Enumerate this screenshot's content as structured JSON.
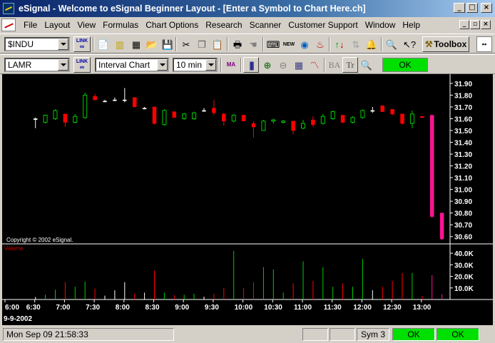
{
  "app": {
    "title": "eSignal - Welcome to eSignal Beginner Layout - [Enter a Symbol to Chart Here.ch]",
    "window_buttons": [
      "_",
      "□",
      "×"
    ],
    "mdi_buttons": [
      "_",
      "▫",
      "×"
    ]
  },
  "menu": [
    "File",
    "Layout",
    "View",
    "Formulas",
    "Chart Options",
    "Research",
    "Scanner",
    "Customer Support",
    "Window",
    "Help"
  ],
  "toolbar1": {
    "symbol_value": "$INDU",
    "link_label": "LINK",
    "toolbox_label": "Toolbox"
  },
  "toolbar2": {
    "symbol_value": "LAMR",
    "link_label": "LINK",
    "chart_type": "Interval Chart",
    "interval": "10 min",
    "ok_label": "OK",
    "ba_label": "BA",
    "tr_label": "Tr"
  },
  "chart_data": {
    "type": "candlestick",
    "copyright": "Copyright © 2002 eSignal.",
    "volume_label": "Volume",
    "date_label": "9-9-2002",
    "y_ticks": [
      31.9,
      31.8,
      31.7,
      31.6,
      31.5,
      31.4,
      31.3,
      31.2,
      31.1,
      31.0,
      30.9,
      30.8,
      30.7,
      30.6
    ],
    "ylim": [
      30.55,
      31.96
    ],
    "volume_ticks": [
      "40.0K",
      "30.0K",
      "20.0K",
      "10.0K"
    ],
    "volume_ylim": [
      0,
      45000
    ],
    "x_ticks": [
      "6:00",
      "6:30",
      "7:00",
      "7:30",
      "8:00",
      "8:30",
      "9:00",
      "9:30",
      "10:00",
      "10:30",
      "11:00",
      "11:30",
      "12:00",
      "12:30",
      "13:00"
    ],
    "bar_minutes": 10,
    "candles": [
      {
        "o": 31.6,
        "h": 31.61,
        "l": 31.52,
        "c": 31.6
      },
      {
        "o": 31.57,
        "h": 31.63,
        "l": 31.56,
        "c": 31.63
      },
      {
        "o": 31.6,
        "h": 31.68,
        "l": 31.59,
        "c": 31.67
      },
      {
        "o": 31.64,
        "h": 31.64,
        "l": 31.53,
        "c": 31.57
      },
      {
        "o": 31.57,
        "h": 31.64,
        "l": 31.56,
        "c": 31.62
      },
      {
        "o": 31.61,
        "h": 31.82,
        "l": 31.6,
        "c": 31.8
      },
      {
        "o": 31.79,
        "h": 31.81,
        "l": 31.76,
        "c": 31.76
      },
      {
        "o": 31.75,
        "h": 31.76,
        "l": 31.74,
        "c": 31.75
      },
      {
        "o": 31.76,
        "h": 31.78,
        "l": 31.75,
        "c": 31.76
      },
      {
        "o": 31.76,
        "h": 31.86,
        "l": 31.74,
        "c": 31.76
      },
      {
        "o": 31.78,
        "h": 31.78,
        "l": 31.7,
        "c": 31.7
      },
      {
        "o": 31.69,
        "h": 31.7,
        "l": 31.68,
        "c": 31.69
      },
      {
        "o": 31.7,
        "h": 31.7,
        "l": 31.55,
        "c": 31.56
      },
      {
        "o": 31.55,
        "h": 31.68,
        "l": 31.54,
        "c": 31.67
      },
      {
        "o": 31.66,
        "h": 31.66,
        "l": 31.61,
        "c": 31.61
      },
      {
        "o": 31.6,
        "h": 31.65,
        "l": 31.59,
        "c": 31.64
      },
      {
        "o": 31.6,
        "h": 31.66,
        "l": 31.59,
        "c": 31.65
      },
      {
        "o": 31.67,
        "h": 31.69,
        "l": 31.66,
        "c": 31.67
      },
      {
        "o": 31.69,
        "h": 31.76,
        "l": 31.63,
        "c": 31.65
      },
      {
        "o": 31.64,
        "h": 31.65,
        "l": 31.54,
        "c": 31.58
      },
      {
        "o": 31.58,
        "h": 31.64,
        "l": 31.57,
        "c": 31.63
      },
      {
        "o": 31.63,
        "h": 31.63,
        "l": 31.58,
        "c": 31.58
      },
      {
        "o": 31.56,
        "h": 31.58,
        "l": 31.44,
        "c": 31.53
      },
      {
        "o": 31.5,
        "h": 31.59,
        "l": 31.5,
        "c": 31.58
      },
      {
        "o": 31.58,
        "h": 31.6,
        "l": 31.56,
        "c": 31.59
      },
      {
        "o": 31.57,
        "h": 31.59,
        "l": 31.56,
        "c": 31.58
      },
      {
        "o": 31.58,
        "h": 31.58,
        "l": 31.47,
        "c": 31.5
      },
      {
        "o": 31.52,
        "h": 31.59,
        "l": 31.51,
        "c": 31.56
      },
      {
        "o": 31.59,
        "h": 31.62,
        "l": 31.53,
        "c": 31.55
      },
      {
        "o": 31.56,
        "h": 31.64,
        "l": 31.55,
        "c": 31.62
      },
      {
        "o": 31.6,
        "h": 31.67,
        "l": 31.59,
        "c": 31.66
      },
      {
        "o": 31.63,
        "h": 31.63,
        "l": 31.56,
        "c": 31.57
      },
      {
        "o": 31.57,
        "h": 31.62,
        "l": 31.56,
        "c": 31.61
      },
      {
        "o": 31.61,
        "h": 31.68,
        "l": 31.6,
        "c": 31.67
      },
      {
        "o": 31.67,
        "h": 31.7,
        "l": 31.65,
        "c": 31.67
      },
      {
        "o": 31.71,
        "h": 31.71,
        "l": 31.66,
        "c": 31.66
      },
      {
        "o": 31.68,
        "h": 31.68,
        "l": 31.63,
        "c": 31.64
      },
      {
        "o": 31.64,
        "h": 31.64,
        "l": 31.55,
        "c": 31.56
      },
      {
        "o": 31.56,
        "h": 31.67,
        "l": 31.52,
        "c": 31.64
      },
      {
        "o": 31.62,
        "h": 31.62,
        "l": 31.61,
        "c": 31.61
      },
      {
        "o": 31.63,
        "h": 31.63,
        "l": 30.76,
        "c": 30.77
      },
      {
        "o": 30.8,
        "h": 30.8,
        "l": 30.57,
        "c": 30.58
      }
    ],
    "volumes": [
      2200,
      4200,
      8500,
      15000,
      11000,
      15500,
      9500,
      3300,
      8000,
      15000,
      5000,
      6000,
      25000,
      6000,
      3800,
      4200,
      5000,
      2500,
      5000,
      10000,
      42000,
      10000,
      15000,
      28000,
      26000,
      6000,
      14000,
      33000,
      16000,
      28000,
      11000,
      14000,
      11000,
      35000,
      8000,
      11000,
      16000,
      23000,
      23000,
      3000,
      21000,
      4500
    ],
    "colors": {
      "up": "#00cc00",
      "down": "#ff0000",
      "neutral": "#ffffff",
      "big_down": "#ff1493",
      "axis_text": "#ffffff",
      "volume_label": "#cc0000"
    }
  },
  "status": {
    "datetime": "Mon Sep 09 21:58:33",
    "sym": "Sym 3",
    "ok1": "OK",
    "ok2": "OK",
    "ok_color": "#00e000"
  }
}
